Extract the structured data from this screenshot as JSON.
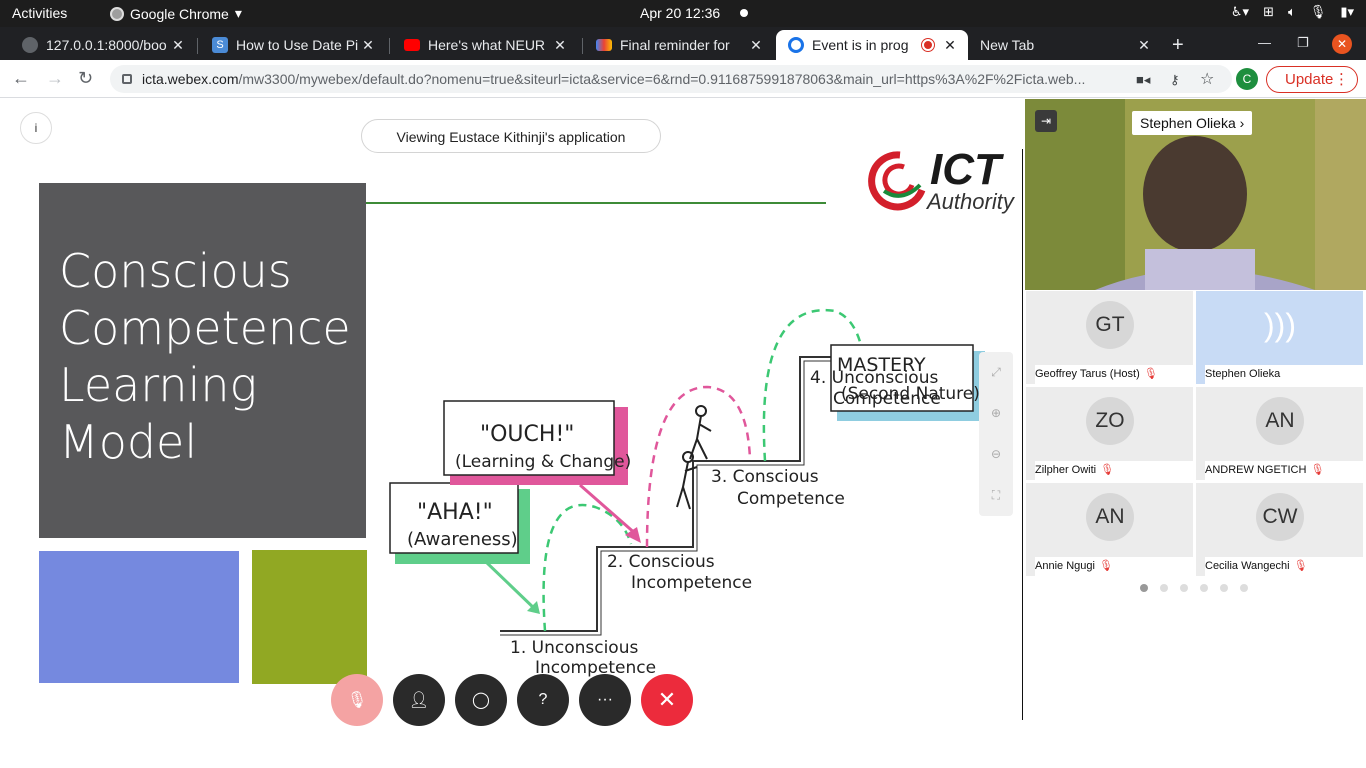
{
  "system_bar": {
    "activities": "Activities",
    "app_name": "Google Chrome",
    "clock": "Apr 20  12:36"
  },
  "tabs": [
    {
      "title": "127.0.0.1:8000/boo",
      "favicon_color": "#5f6368",
      "active": false
    },
    {
      "title": "How to Use Date Pi",
      "favicon_color": "#4b8bd6",
      "active": false
    },
    {
      "title": "Here's what NEUR",
      "favicon_color": "#ff0000",
      "active": false
    },
    {
      "title": "Final reminder for",
      "favicon_color": "#ea4335",
      "active": false
    },
    {
      "title": "Event is in prog",
      "favicon_color": "#1a73e8",
      "active": true
    },
    {
      "title": "New Tab",
      "favicon_color": "",
      "active": false
    }
  ],
  "address_bar": {
    "host": "icta.webex.com",
    "path": "/mw3300/mywebex/default.do?nomenu=true&siteurl=icta&service=6&rnd=0.9116875991878063&main_url=https%3A%2F%2Ficta.web..."
  },
  "profile_initial": "C",
  "update_label": "Update",
  "share": {
    "info_label": "i",
    "viewing_label": "Viewing Eustace Kithinji's application",
    "slide_title": "Conscious Competence Learning Model",
    "logo_text": "ICT",
    "logo_subtext": "Authority",
    "diagram": {
      "stage1_line1": "1. Unconscious",
      "stage1_line2": "Incompetence",
      "stage2_line1": "2. Conscious",
      "stage2_line2": "Incompetence",
      "stage3_line1": "3. Conscious",
      "stage3_line2": "Competence",
      "stage4_line1": "4. Unconscious",
      "stage4_line2": "Competence",
      "aha_line1": "\"AHA!\"",
      "aha_line2": "(Awareness)",
      "ouch_line1": "\"OUCH!\"",
      "ouch_line2": "(Learning & Change)",
      "mastery_line1": "MASTERY",
      "mastery_line2": "(Second Nature)"
    }
  },
  "video": {
    "active_speaker": "Stephen Olieka",
    "participants": [
      {
        "initials": "GT",
        "name": "Geoffrey Tarus (Host)",
        "muted": true,
        "speaking": false
      },
      {
        "initials": ")))",
        "name": "Stephen Olieka",
        "muted": false,
        "speaking": true
      },
      {
        "initials": "ZO",
        "name": "Zilpher Owiti",
        "muted": true,
        "speaking": false
      },
      {
        "initials": "AN",
        "name": "ANDREW NGETICH",
        "muted": true,
        "speaking": false
      },
      {
        "initials": "AN",
        "name": "Annie Ngugi",
        "muted": true,
        "speaking": false
      },
      {
        "initials": "CW",
        "name": "Cecilia Wangechi",
        "muted": true,
        "speaking": false
      }
    ],
    "pages": 6,
    "current_page": 1
  },
  "colors": {
    "slide_gray": "#58585a",
    "slide_blue": "#7589df",
    "slide_olive": "#91a823",
    "end_call": "#ec2b3c",
    "aha_box": "#5fce8a",
    "ouch_box": "#e0579b",
    "mastery_box": "#8fcde0"
  }
}
